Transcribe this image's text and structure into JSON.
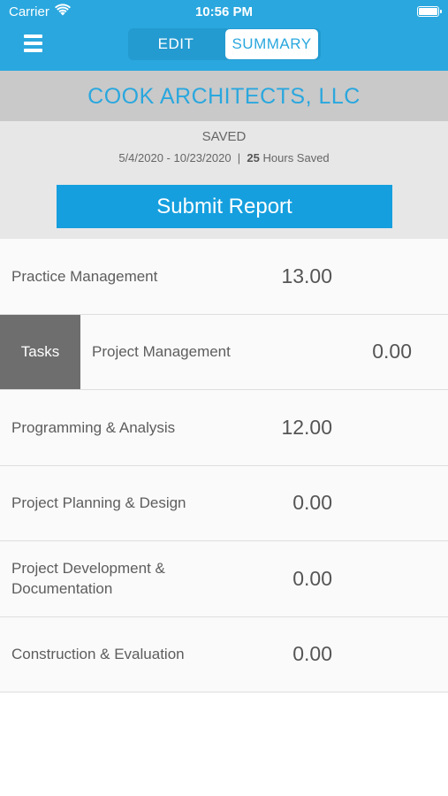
{
  "status_bar": {
    "carrier": "Carrier",
    "time": "10:56 PM"
  },
  "header": {
    "tabs": [
      {
        "label": "EDIT",
        "selected": false
      },
      {
        "label": "SUMMARY",
        "selected": true
      }
    ]
  },
  "company": {
    "name": "COOK ARCHITECTS, LLC"
  },
  "report": {
    "status": "SAVED",
    "date_range": "5/4/2020 - 10/23/2020",
    "separator": "|",
    "hours": "25",
    "hours_label": "Hours Saved",
    "submit_label": "Submit Report"
  },
  "rows": [
    {
      "label": "Practice Management",
      "value": "13.00"
    },
    {
      "label": "Project Management",
      "value": "0.00",
      "action_label": "Tasks"
    },
    {
      "label": "Programming & Analysis",
      "value": "12.00"
    },
    {
      "label": "Project Planning & Design",
      "value": "0.00"
    },
    {
      "label": "Project Development & Documentation",
      "value": "0.00"
    },
    {
      "label": "Construction & Evaluation",
      "value": "0.00"
    }
  ],
  "colors": {
    "accent": "#2aa7de",
    "button": "#159fde",
    "company_bar": "#c9c9c9",
    "swipe_action": "#6e6e6e"
  }
}
